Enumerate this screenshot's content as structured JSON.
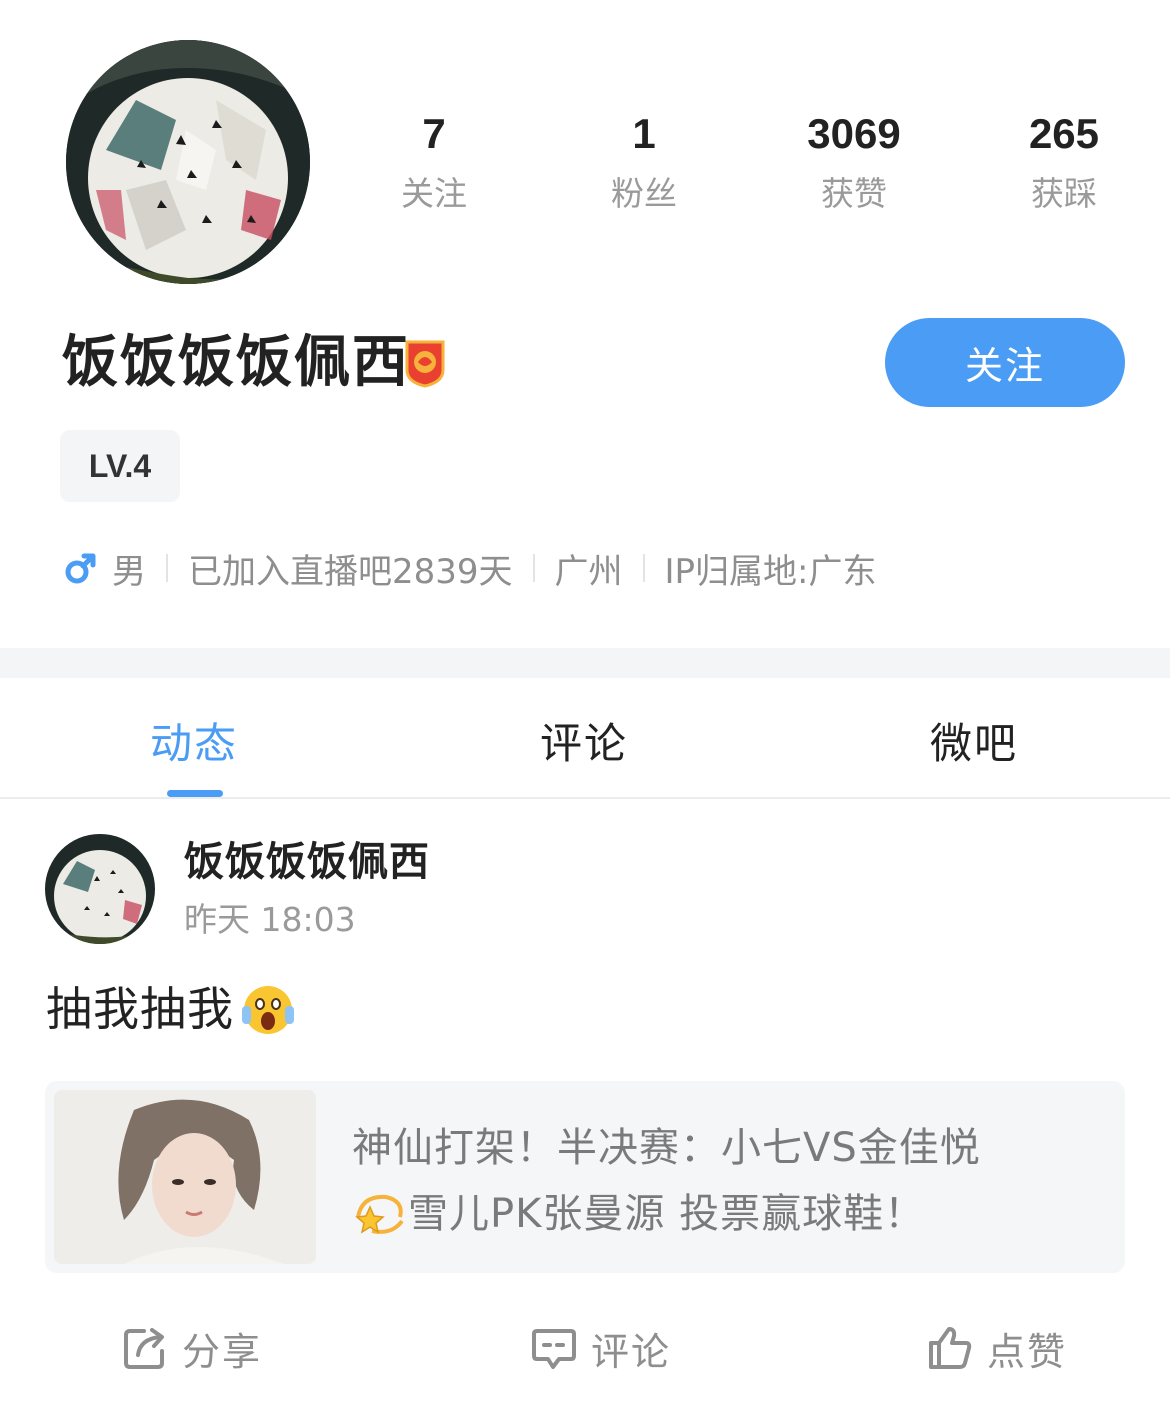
{
  "profile": {
    "stats": [
      {
        "value": "7",
        "label": "关注"
      },
      {
        "value": "1",
        "label": "粉丝"
      },
      {
        "value": "3069",
        "label": "获赞"
      },
      {
        "value": "265",
        "label": "获踩"
      }
    ],
    "nickname": "饭饭饭饭佩西",
    "follow_label": "关注",
    "level": "LV.4",
    "gender": "男",
    "joined": "已加入直播吧2839天",
    "city": "广州",
    "ip": "IP归属地:广东"
  },
  "tabs": [
    {
      "label": "动态",
      "active": true
    },
    {
      "label": "评论",
      "active": false
    },
    {
      "label": "微吧",
      "active": false
    }
  ],
  "post": {
    "author": "饭饭饭饭佩西",
    "time": "昨天 18:03",
    "text": "抽我抽我",
    "link_title_line1": "神仙打架！半决赛：小七VS金佳悦",
    "link_title_line2": "雪儿PK张曼源 投票赢球鞋！"
  },
  "actions": {
    "share": "分享",
    "comment": "评论",
    "like": "点赞"
  },
  "colors": {
    "accent": "#4a9cf4",
    "muted": "#9a9a9a",
    "band": "#f4f5f7"
  }
}
